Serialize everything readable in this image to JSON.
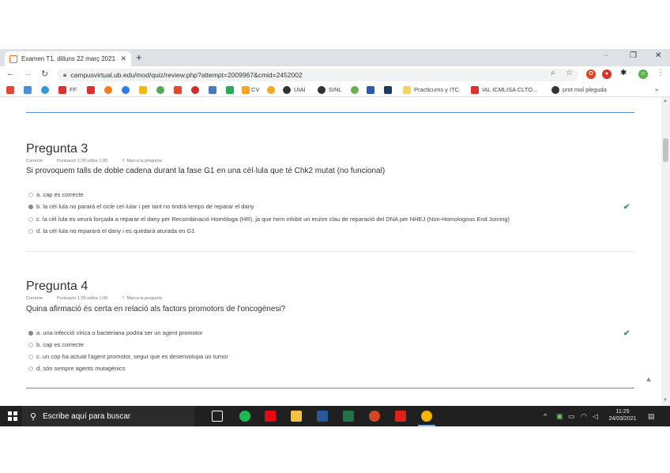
{
  "browser": {
    "tab_title": "Examen T1, dilluns 22 març 2021",
    "tab_close": "✕",
    "new_tab": "+",
    "url": "campusvirtual.ub.edu/mod/quiz/review.php?attempt=2009967&cmid=2452002",
    "bookmarks": [
      "CV",
      "UIAI",
      "SINL",
      "Practicums y ITC",
      "IAL ICMLISA CLTO...",
      "prot mol pleguda"
    ]
  },
  "questions": [
    {
      "title": "Pregunta 3",
      "status": "Correcte",
      "score": "Puntuació 1,00 sobre 1,00",
      "flag": "Marca la pregunta",
      "text": "Si provoquem talls de doble cadena durant la fase G1 en una cèl·lula que té Chk2 mutat (no funcional)",
      "options": [
        "a. cap es correcte",
        "b. la cèl·lula no pararà el cicle cel·lular i per tant no tindrà temps de reparar el dany",
        "c. la cèl·lula es veurà forçada a reparar el dany per Recombinació Homòloga (HR), ja que hem inhibit un enzim clau de reparació del DNA per NHEJ (Non-Homologous End Joining)",
        "d. la cèl·lula no repararà el dany i es quedarà aturada en G1"
      ],
      "selected": 1
    },
    {
      "title": "Pregunta 4",
      "status": "Correcte",
      "score": "Puntuació 1,00 sobre 1,00",
      "flag": "Marca la pregunta",
      "text": "Quina afirmació és certa en relació als factors promotors de l'oncogènesi?",
      "options": [
        "a. una infecció vírica o bacteriana podria ser un agent promotor",
        "b. cap es correcte",
        "c. un cop ha actuat l'agent promotor, segur que es desenvolupa un tumor",
        "d. són sempre agents mutagènics"
      ],
      "selected": 0
    }
  ],
  "taskbar": {
    "search_placeholder": "Escribe aquí para buscar",
    "time": "11:25",
    "date": "24/03/2021"
  },
  "colors": {
    "accent": "#5a8fd0",
    "correct": "#2e9e45"
  }
}
